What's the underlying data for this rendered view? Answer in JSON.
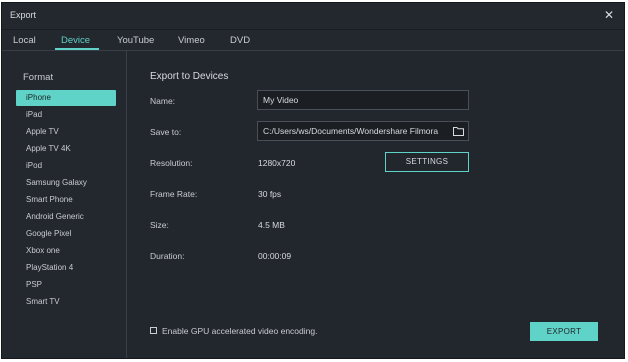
{
  "window": {
    "title": "Export",
    "close_glyph": "✕"
  },
  "tabs": [
    {
      "label": "Local"
    },
    {
      "label": "Device"
    },
    {
      "label": "YouTube"
    },
    {
      "label": "Vimeo"
    },
    {
      "label": "DVD"
    }
  ],
  "active_tab": "Device",
  "sidebar": {
    "heading": "Format",
    "items": [
      {
        "label": "iPhone"
      },
      {
        "label": "iPad"
      },
      {
        "label": "Apple TV"
      },
      {
        "label": "Apple TV 4K"
      },
      {
        "label": "iPod"
      },
      {
        "label": "Samsung Galaxy"
      },
      {
        "label": "Smart Phone"
      },
      {
        "label": "Android Generic"
      },
      {
        "label": "Google Pixel"
      },
      {
        "label": "Xbox one"
      },
      {
        "label": "PlayStation 4"
      },
      {
        "label": "PSP"
      },
      {
        "label": "Smart TV"
      }
    ],
    "selected": "iPhone"
  },
  "main": {
    "section_title": "Export to Devices",
    "name_label": "Name:",
    "name_value": "My Video",
    "save_label": "Save to:",
    "save_value": "C:/Users/ws/Documents/Wondershare Filmora",
    "resolution_label": "Resolution:",
    "resolution_value": "1280x720",
    "settings_button": "SETTINGS",
    "framerate_label": "Frame Rate:",
    "framerate_value": "30 fps",
    "size_label": "Size:",
    "size_value": "4.5 MB",
    "duration_label": "Duration:",
    "duration_value": "00:00:09",
    "gpu_label": "Enable GPU accelerated video encoding.",
    "gpu_checked": false,
    "export_button": "EXPORT"
  },
  "colors": {
    "accent": "#5fd3c7",
    "background": "#22262d",
    "panel": "#23272e",
    "text": "#c9ccd1"
  }
}
